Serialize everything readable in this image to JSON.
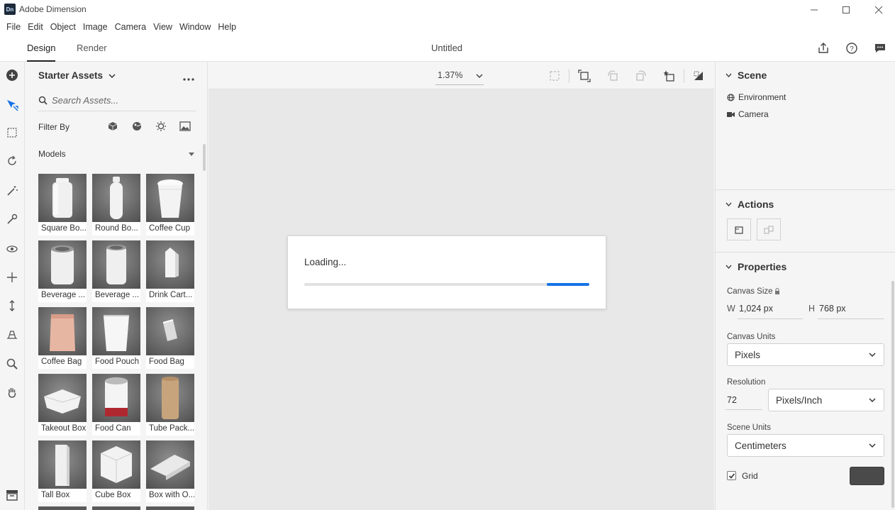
{
  "window": {
    "app_logo": "Dn",
    "title": "Adobe Dimension",
    "controls": [
      "minimize-icon",
      "maximize-icon",
      "close-icon"
    ]
  },
  "menu": [
    "File",
    "Edit",
    "Object",
    "Image",
    "Camera",
    "View",
    "Window",
    "Help"
  ],
  "tabs": {
    "design": "Design",
    "render": "Render"
  },
  "document_title": "Untitled",
  "header_icons": [
    "share-icon",
    "help-icon",
    "feedback-icon"
  ],
  "tools": [
    "add-icon",
    "select-icon",
    "marquee-icon",
    "rotate-icon",
    "magic-wand-icon",
    "sample-icon",
    "orbit-icon",
    "pan-icon",
    "dolly-icon",
    "horizon-icon",
    "zoom-icon",
    "hand-icon"
  ],
  "assets": {
    "title": "Starter Assets",
    "search_placeholder": "Search Assets...",
    "filter_label": "Filter By",
    "filter_icons": [
      "model-filter-icon",
      "material-filter-icon",
      "light-filter-icon",
      "image-filter-icon"
    ],
    "section": "Models",
    "items": [
      {
        "label": "Square Bo...",
        "shape": "bottle"
      },
      {
        "label": "Round Bo...",
        "shape": "round-bottle"
      },
      {
        "label": "Coffee Cup",
        "shape": "cup"
      },
      {
        "label": "Beverage ...",
        "shape": "can"
      },
      {
        "label": "Beverage ...",
        "shape": "can2"
      },
      {
        "label": "Drink Cart...",
        "shape": "carton"
      },
      {
        "label": "Coffee Bag",
        "shape": "bag"
      },
      {
        "label": "Food Pouch",
        "shape": "pouch"
      },
      {
        "label": "Food Bag",
        "shape": "foodbag"
      },
      {
        "label": "Takeout Box",
        "shape": "takeout"
      },
      {
        "label": "Food Can",
        "shape": "foodcan"
      },
      {
        "label": "Tube Pack...",
        "shape": "tube"
      },
      {
        "label": "Tall Box",
        "shape": "tallbox"
      },
      {
        "label": "Cube Box",
        "shape": "cube"
      },
      {
        "label": "Box with O...",
        "shape": "flatbox"
      }
    ]
  },
  "viewport": {
    "zoom": "1.37%",
    "loading": {
      "text": "Loading...",
      "progress_start": 0.85,
      "progress_end": 1.0
    }
  },
  "scene": {
    "title": "Scene",
    "items": [
      {
        "label": "Environment",
        "icon": "globe-icon"
      },
      {
        "label": "Camera",
        "icon": "camera-icon"
      }
    ]
  },
  "actions": {
    "title": "Actions"
  },
  "properties": {
    "title": "Properties",
    "canvas_size_label": "Canvas Size",
    "w_label": "W",
    "w_value": "1,024 px",
    "h_label": "H",
    "h_value": "768 px",
    "canvas_units_label": "Canvas Units",
    "canvas_units": "Pixels",
    "resolution_label": "Resolution",
    "resolution_value": "72",
    "resolution_unit": "Pixels/Inch",
    "scene_units_label": "Scene Units",
    "scene_units": "Centimeters",
    "grid_label": "Grid",
    "grid_checked": true,
    "grid_color": "#4a4a4a"
  },
  "colors": {
    "accent": "#1473e6"
  }
}
